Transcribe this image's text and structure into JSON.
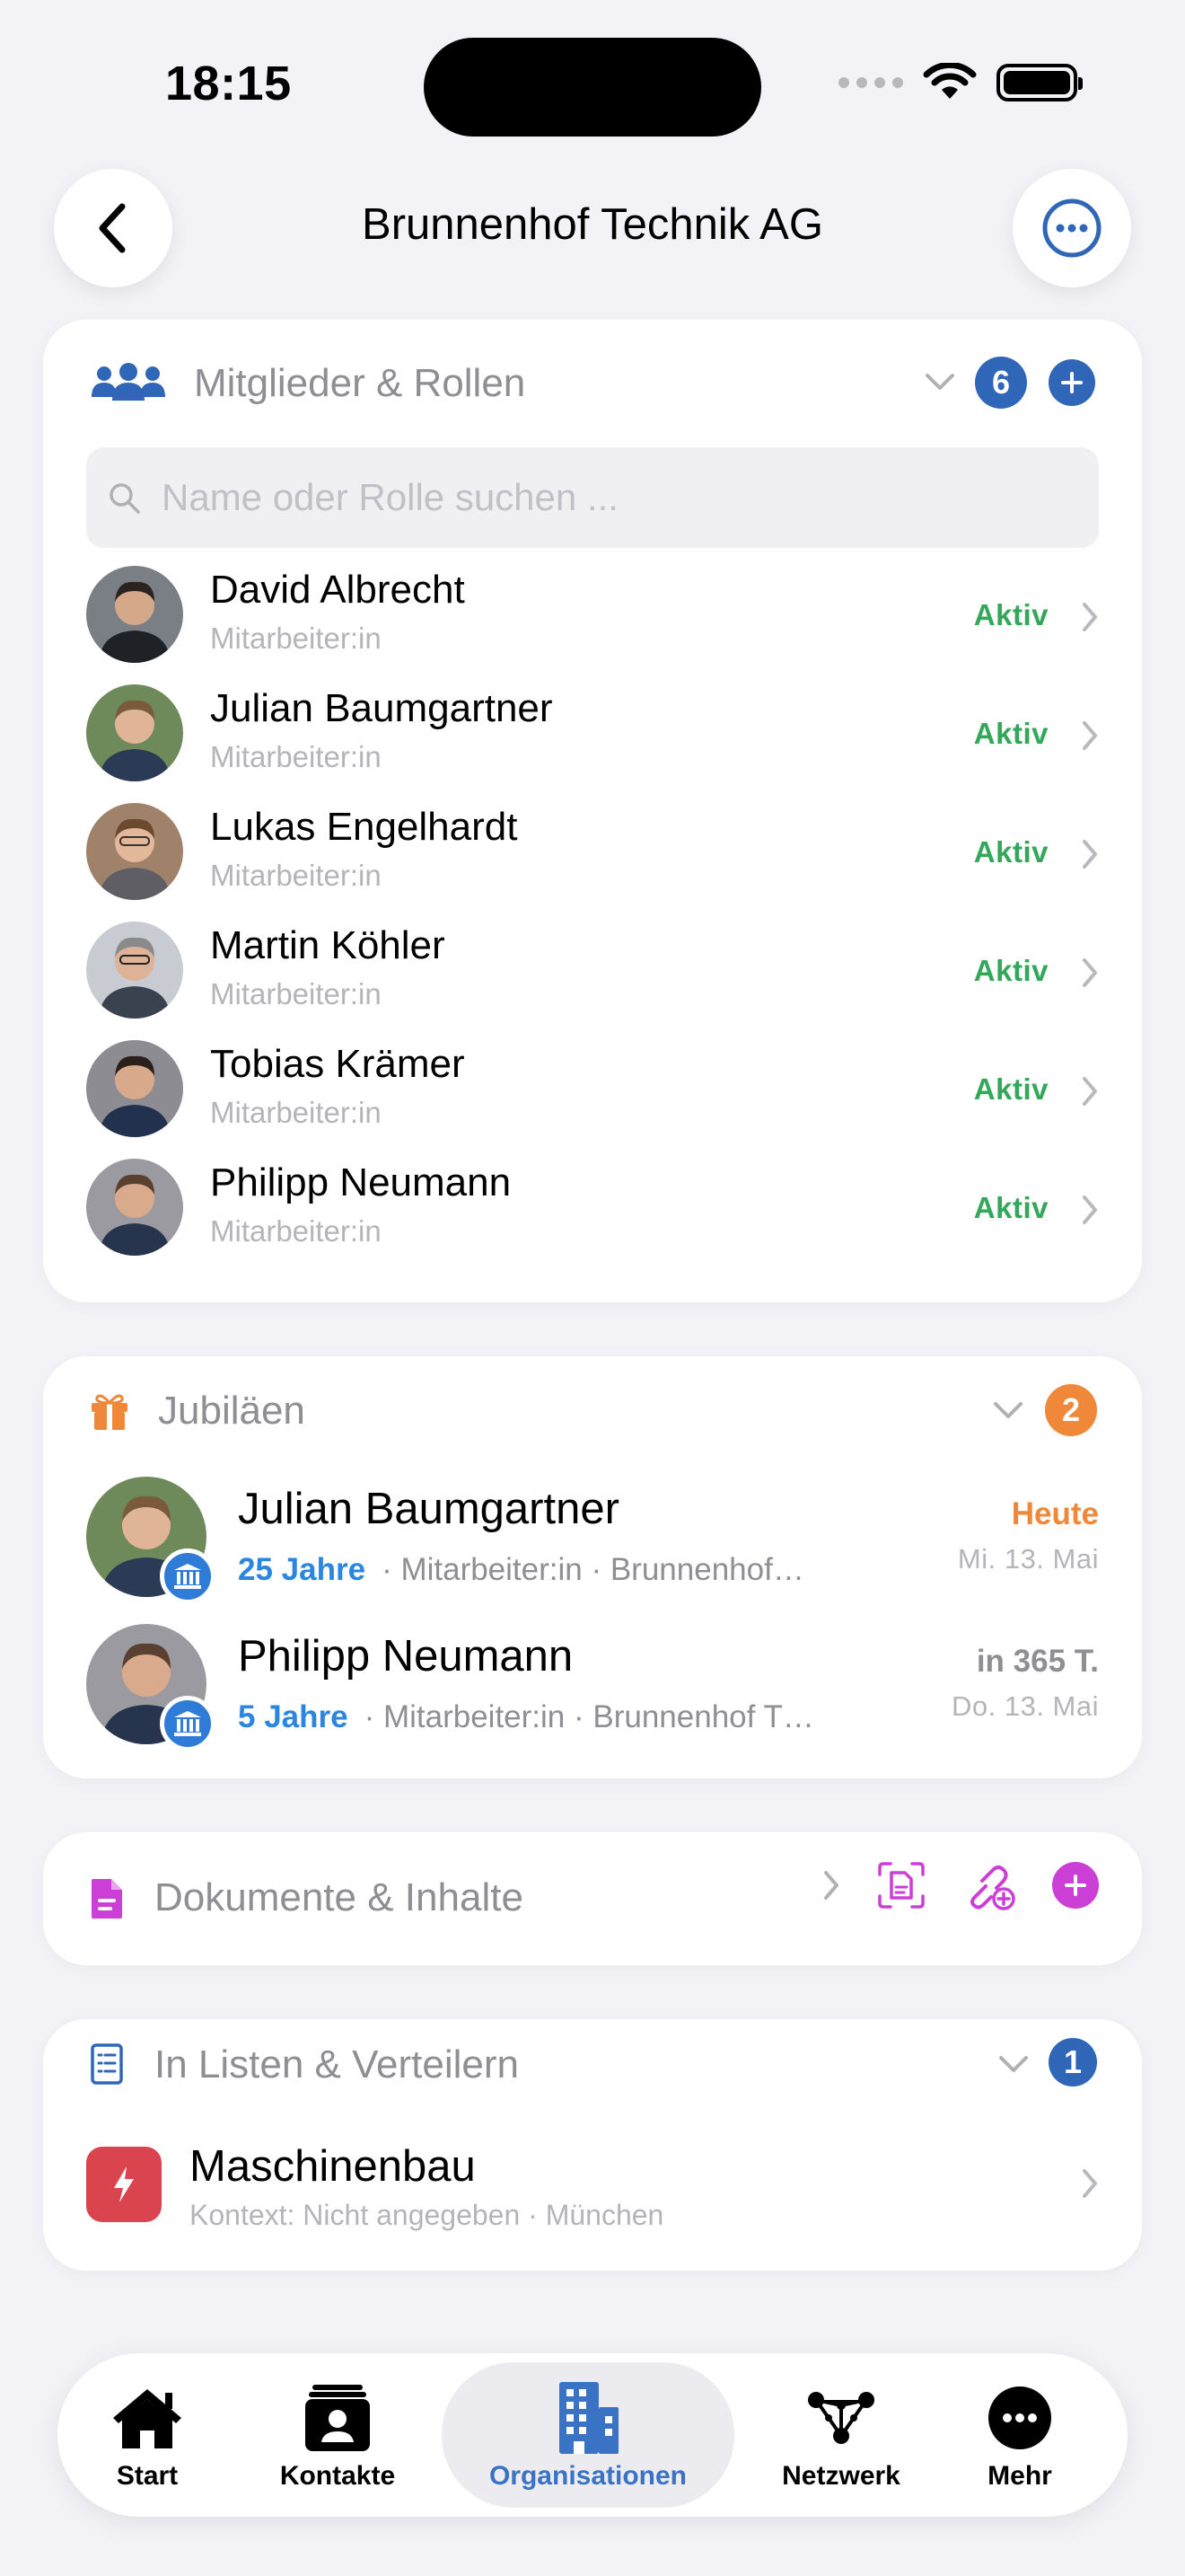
{
  "status_bar": {
    "time": "18:15"
  },
  "header": {
    "title": "Brunnenhof Technik AG"
  },
  "colors": {
    "accent_blue": "#2f66b8",
    "status_green": "#34a85a",
    "orange": "#f0883a",
    "magenta": "#cc3fd6",
    "red": "#d9444f"
  },
  "members": {
    "title": "Mitglieder & Rollen",
    "count": "6",
    "search_placeholder": "Name oder Rolle suchen ...",
    "items": [
      {
        "name": "David Albrecht",
        "role": "Mitarbeiter:in",
        "status": "Aktiv"
      },
      {
        "name": "Julian Baumgartner",
        "role": "Mitarbeiter:in",
        "status": "Aktiv"
      },
      {
        "name": "Lukas Engelhardt",
        "role": "Mitarbeiter:in",
        "status": "Aktiv"
      },
      {
        "name": "Martin Köhler",
        "role": "Mitarbeiter:in",
        "status": "Aktiv"
      },
      {
        "name": "Tobias Krämer",
        "role": "Mitarbeiter:in",
        "status": "Aktiv"
      },
      {
        "name": "Philipp Neumann",
        "role": "Mitarbeiter:in",
        "status": "Aktiv"
      }
    ]
  },
  "jubilees": {
    "title": "Jubiläen",
    "count": "2",
    "items": [
      {
        "name": "Julian Baumgartner",
        "years": "25 Jahre",
        "detail": "· Mitarbeiter:in · Brunnenhof…",
        "when": "Heute",
        "date": "Mi. 13. Mai"
      },
      {
        "name": "Philipp Neumann",
        "years": "5 Jahre",
        "detail": "· Mitarbeiter:in · Brunnenhof T…",
        "when": "in 365 T.",
        "date": "Do. 13. Mai"
      }
    ]
  },
  "documents": {
    "title": "Dokumente & Inhalte"
  },
  "lists": {
    "title": "In Listen & Verteilern",
    "count": "1",
    "items": [
      {
        "name": "Maschinenbau",
        "subtitle": "Kontext: Nicht angegeben · München"
      }
    ]
  },
  "tab_bar": {
    "items": [
      {
        "label": "Start",
        "icon": "house-icon"
      },
      {
        "label": "Kontakte",
        "icon": "contacts-icon"
      },
      {
        "label": "Organisationen",
        "icon": "building-icon",
        "active": true
      },
      {
        "label": "Netzwerk",
        "icon": "network-icon"
      },
      {
        "label": "Mehr",
        "icon": "more-icon"
      }
    ]
  }
}
